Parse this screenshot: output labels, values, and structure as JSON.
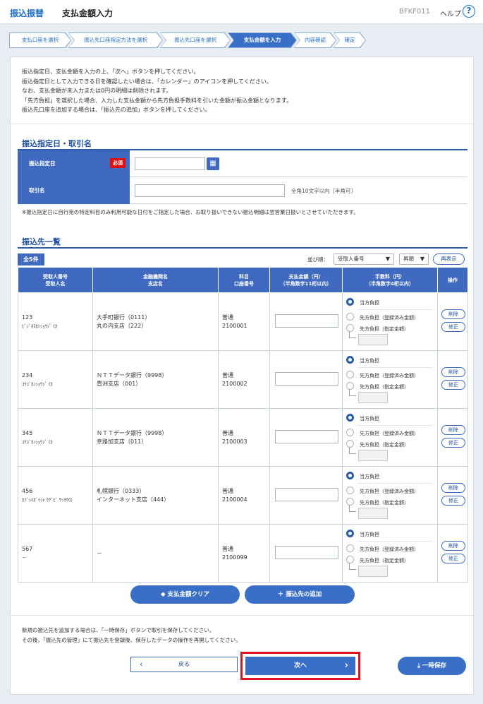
{
  "header": {
    "section": "振込振替",
    "title": "支払金額入力",
    "screen_code": "BFKF011",
    "help_label": "ヘルプ",
    "help_icon": "?"
  },
  "steps": [
    "支払口座を選択",
    "振込先口座指定方法を選択",
    "振込先口座を選択",
    "支払金額を入力",
    "内容確認",
    "確定"
  ],
  "intro_lines": [
    "振込指定日、支払金額を入力の上、「次へ」ボタンを押してください。",
    "振込指定日として入力できる日を確認したい場合は、「カレンダー」のアイコンを押してください。",
    "なお、支払金額が未入力または0円の明細は削除されます。",
    "「先方負担」を選択した場合、入力した支払金額から先方負担手数料を引いた金額が振込金額となります。",
    "振込先口座を追加する場合は、「振込先の追加」ボタンを押してください。"
  ],
  "section1": {
    "title": "振込指定日・取引名",
    "date_label": "振込指定日",
    "required_badge": "必須",
    "date_value": "",
    "calendar_icon": "calendar-icon",
    "name_label": "取引名",
    "name_value": "",
    "name_hint": "全角10文字以内［半角可］",
    "note": "※振込指定日に自行宛の特定科目のみ利用可能な日付をご指定した場合、お取り扱いできない振込明細は翌営業日扱いとさせていただきます。"
  },
  "section2": {
    "title": "振込先一覧",
    "count": "全5件",
    "sort_label": "並び順：",
    "sort_field": "受取人番号",
    "sort_order": "昇順",
    "redisplay": "再表示",
    "columns": [
      [
        "受取人番号",
        "受取人名"
      ],
      [
        "金融機関名",
        "支店名"
      ],
      [
        "科目",
        "口座番号"
      ],
      [
        "支払金額（円）",
        "（半角数字11桁以内）"
      ],
      [
        "手数料（円）",
        "（半角数字4桁以内）"
      ],
      [
        "操作",
        ""
      ]
    ],
    "fee_options": [
      "当方負担",
      "先方負担（登録済み金額）",
      "先方負担（指定金額）"
    ],
    "delete_label": "削除",
    "edit_label": "修正",
    "rows": [
      {
        "no": "123",
        "name": "ﾋﾞｼﾞﾈｽｶﾝｼｮｳｼﾞ (ｶ",
        "bank": "大手町銀行（0111）",
        "branch": "丸の内支店（222）",
        "type": "普通",
        "account": "2100001",
        "amount": ""
      },
      {
        "no": "234",
        "name": "ｺｳｺﾞｶﾝｼｮｳｼﾞ (ｶ",
        "bank": "ＮＴＴデータ銀行（9998）",
        "branch": "豊洲支店（001）",
        "type": "普通",
        "account": "2100002",
        "amount": ""
      },
      {
        "no": "345",
        "name": "ｺｳｺﾞｶﾝｼｮｳｼﾞ (ｶ",
        "bank": "ＮＴＴデータ銀行（9998）",
        "branch": "幸路加支店（011）",
        "type": "普通",
        "account": "2100003",
        "amount": ""
      },
      {
        "no": "456",
        "name": "ｶﾌﾞｼｷｶﾞｲｼｬ ｳｸﾞﾋﾞ ｻｯﾖｳ(ｶ",
        "bank": "札幌銀行（0333）",
        "branch": "インターネット支店（444）",
        "type": "普通",
        "account": "2100004",
        "amount": ""
      },
      {
        "no": "567",
        "name": "－",
        "bank": "－",
        "branch": "",
        "type": "普通",
        "account": "2100099",
        "amount": ""
      }
    ],
    "clear_button": "支払金額クリア",
    "add_button": "振込先の追加"
  },
  "footer": {
    "note_lines": [
      "新規の振込先を追加する場合は、「一時保存」ボタンで取引を保存してください。",
      "その後、「振込先の管理」にて振込先を登録後、保存したデータの操作を再開してください。"
    ],
    "back_button": "戻る",
    "next_button": "次へ",
    "save_button": "一時保存"
  }
}
